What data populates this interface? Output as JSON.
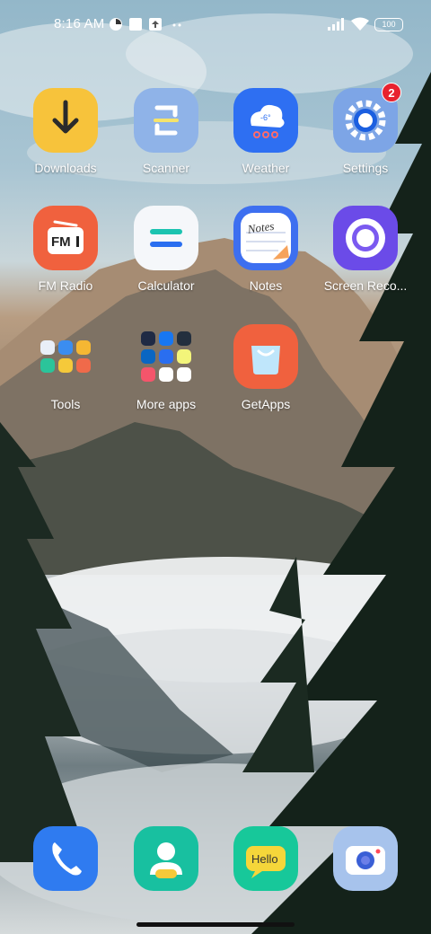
{
  "status_bar": {
    "time": "8:16 AM",
    "battery": "100",
    "left_icons": [
      "data-saver-icon",
      "square-notification-icon",
      "upload-icon",
      "more-dots-icon"
    ],
    "right_icons": [
      "signal-icon",
      "wifi-icon",
      "battery-icon"
    ]
  },
  "apps": {
    "downloads": {
      "label": "Downloads",
      "icon": "download-arrow-icon",
      "color": "#f7c33b"
    },
    "scanner": {
      "label": "Scanner",
      "icon": "scanner-icon",
      "color": "#8fb3e8"
    },
    "weather": {
      "label": "Weather",
      "icon": "weather-cloud-icon",
      "color": "#2e6ff2",
      "temp": "-6°"
    },
    "settings": {
      "label": "Settings",
      "icon": "gear-icon",
      "color": "#7da5e6",
      "badge": "2"
    },
    "fm_radio": {
      "label": "FM Radio",
      "icon": "radio-icon",
      "color": "#f0613e",
      "text": "FM"
    },
    "calculator": {
      "label": "Calculator",
      "icon": "calculator-icon",
      "color": "#f5f7fa"
    },
    "notes": {
      "label": "Notes",
      "icon": "notes-icon",
      "color": "#3d6ff0",
      "text": "Notes"
    },
    "screen_recorder": {
      "label": "Screen Reco...",
      "icon": "record-circle-icon",
      "color": "#6b4be8"
    },
    "tools": {
      "label": "Tools",
      "icon": "folder-icon"
    },
    "more_apps": {
      "label": "More apps",
      "icon": "folder-icon"
    },
    "getapps": {
      "label": "GetApps",
      "icon": "shopping-bag-icon",
      "color": "#f0613e"
    }
  },
  "dock": {
    "phone": {
      "icon": "phone-icon",
      "color": "#2f7bf0"
    },
    "contacts": {
      "icon": "contacts-icon",
      "color": "#18c0a0"
    },
    "messages": {
      "icon": "message-bubble-icon",
      "color": "#17c89a",
      "text": "Hello"
    },
    "camera": {
      "icon": "camera-icon",
      "color": "#a7c3ec"
    }
  }
}
